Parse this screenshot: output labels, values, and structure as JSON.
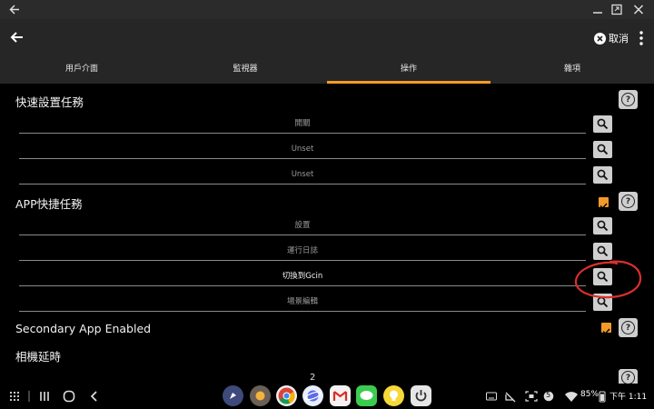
{
  "header": {
    "cancel_label": "取消"
  },
  "tabs": [
    {
      "label": "用戶介面",
      "active": false
    },
    {
      "label": "監視器",
      "active": false
    },
    {
      "label": "操作",
      "active": true
    },
    {
      "label": "雜項",
      "active": false
    }
  ],
  "quick_tasks": {
    "title": "快速設置任務",
    "items": [
      "開關",
      "Unset",
      "Unset"
    ]
  },
  "app_shortcut_tasks": {
    "title": "APP快捷任務",
    "enabled": true,
    "items": [
      "設置",
      "運行日誌",
      "切換到Gcin",
      "場景編輯"
    ],
    "selected_item": "切換到Gcin"
  },
  "secondary_app": {
    "label": "Secondary App Enabled",
    "enabled": true
  },
  "camera_delay": {
    "label": "相機延時"
  },
  "dock": {
    "page_number": "2",
    "apps": [
      "compass-app-icon",
      "sun-app-icon",
      "chrome-icon",
      "planet-app-icon",
      "gmail-icon",
      "line-icon",
      "lightbulb-icon",
      "power-app-icon"
    ]
  },
  "status_bar": {
    "notification_badge": "5",
    "battery": "85%",
    "time": "下午 1:11"
  },
  "colors": {
    "accent": "#f39a2a",
    "annotation": "#d9302c",
    "bar_bg": "#262626"
  }
}
